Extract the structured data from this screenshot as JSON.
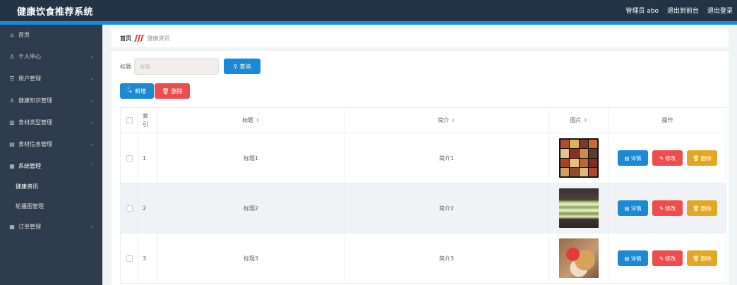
{
  "app": {
    "title": "健康饮食推荐系统",
    "user_label": "管理员 abo",
    "back_front_label": "退出到前台",
    "logout_label": "退出登录"
  },
  "sidebar": {
    "items": [
      {
        "label": "首页",
        "icon": "home-icon"
      },
      {
        "label": "个人中心",
        "icon": "user-icon"
      },
      {
        "label": "用户管理",
        "icon": "list-icon"
      },
      {
        "label": "健康知识管理",
        "icon": "user-icon"
      },
      {
        "label": "食材类型管理",
        "icon": "bar-chart-icon"
      },
      {
        "label": "食材信息管理",
        "icon": "document-icon"
      },
      {
        "label": "系统管理",
        "icon": "grid-icon"
      },
      {
        "label": "健康资讯",
        "icon": ""
      },
      {
        "label": "轮播图管理",
        "icon": ""
      },
      {
        "label": "订单管理",
        "icon": "grid-icon"
      }
    ]
  },
  "breadcrumb": {
    "home": "首页",
    "current": "健康资讯"
  },
  "search": {
    "label": "标题",
    "placeholder": "标题",
    "query_label": "查询"
  },
  "toolbar": {
    "add_label": "新增",
    "delete_label": "删除"
  },
  "table": {
    "headers": {
      "index": "索引",
      "title": "标题",
      "intro": "简介",
      "image": "图片",
      "ops": "操作"
    },
    "rows": [
      {
        "index": "1",
        "title": "标题1",
        "intro": "简介1"
      },
      {
        "index": "2",
        "title": "标题2",
        "intro": "简介2"
      },
      {
        "index": "3",
        "title": "标题3",
        "intro": "简介3"
      }
    ],
    "op_labels": {
      "detail": "详情",
      "edit": "修改",
      "delete": "删除"
    }
  },
  "colors": {
    "topbar": "#243447",
    "sidebar": "#2f3c4d",
    "primary": "#1a8ad6",
    "danger": "#ee4d4d",
    "warning": "#e3a823"
  }
}
